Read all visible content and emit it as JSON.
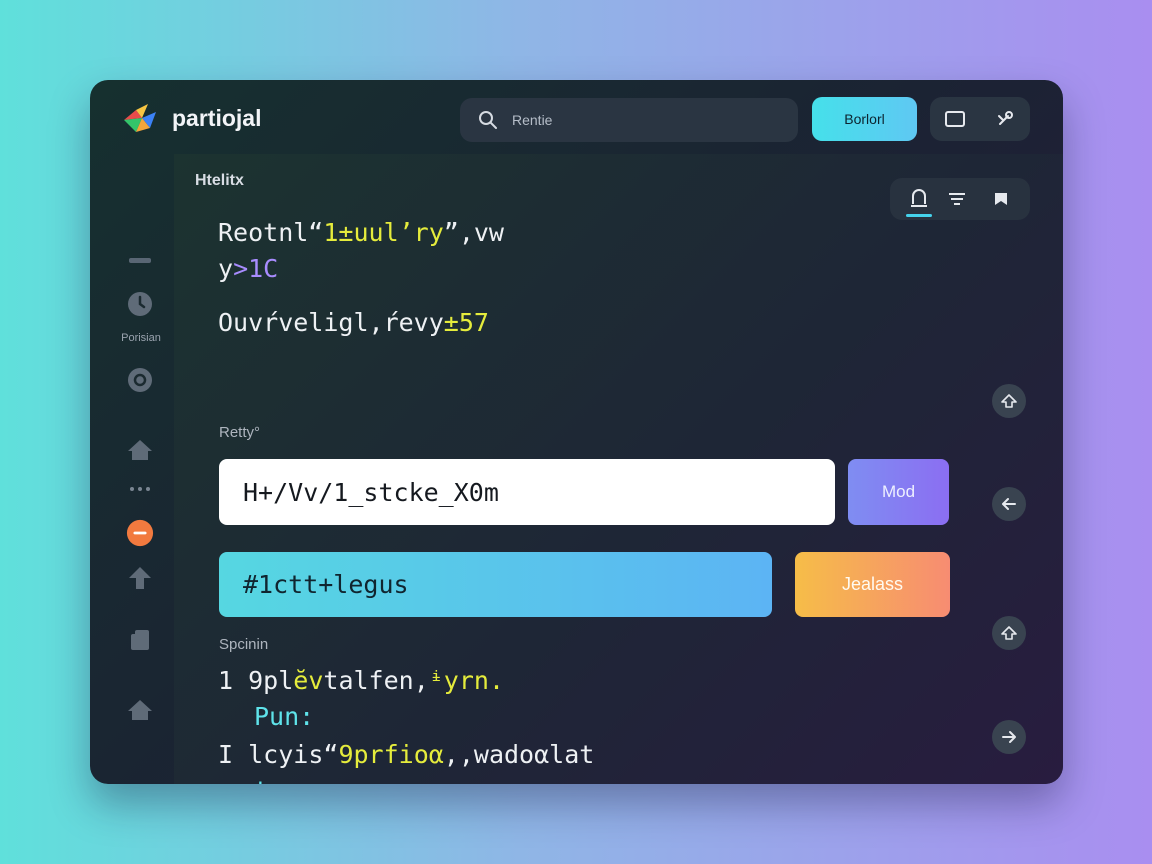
{
  "app": {
    "title": "partiojal"
  },
  "search": {
    "placeholder": "Rentie"
  },
  "toolbar": {
    "primary_label": "Borlorl"
  },
  "sidebar": {
    "label": "Porisian"
  },
  "panel": {
    "heading": "Htelitx",
    "code_block_1": {
      "line1_a": "Reotnl“",
      "line1_b": "1±uul’ry",
      "line1_c": "”,vw",
      "line2_a": "y",
      "line2_b": ">",
      "line2_c": "1C",
      "line3_a": "Ouvŕveligl,ŕevy",
      "line3_b": "±57"
    },
    "label_retry": "Retty°",
    "input_value": "H+/Vv/1_stcke_X0m",
    "mod_button": "Mod",
    "gradient_field_value": "#1ctt+legus",
    "warm_button": "Jealass",
    "section_label": "Spcinin",
    "code_block_2": {
      "l1_num": "1",
      "l1_a": "9pl",
      "l1_b": "ĕv",
      "l1_c": "talfen,",
      "l1_d": "ᶤyrn.",
      "l2": "Pun:",
      "l3_num": "I",
      "l3_a": "lcyis“",
      "l3_b": "9prfioα",
      "l3_c": ",,wadoαlat",
      "l4": "tarm."
    }
  },
  "colors": {
    "accent_cyan": "#45e0ea",
    "accent_purple": "#8b6ef2",
    "accent_orange": "#f78c72",
    "code_yellow": "#e5ec3c"
  }
}
